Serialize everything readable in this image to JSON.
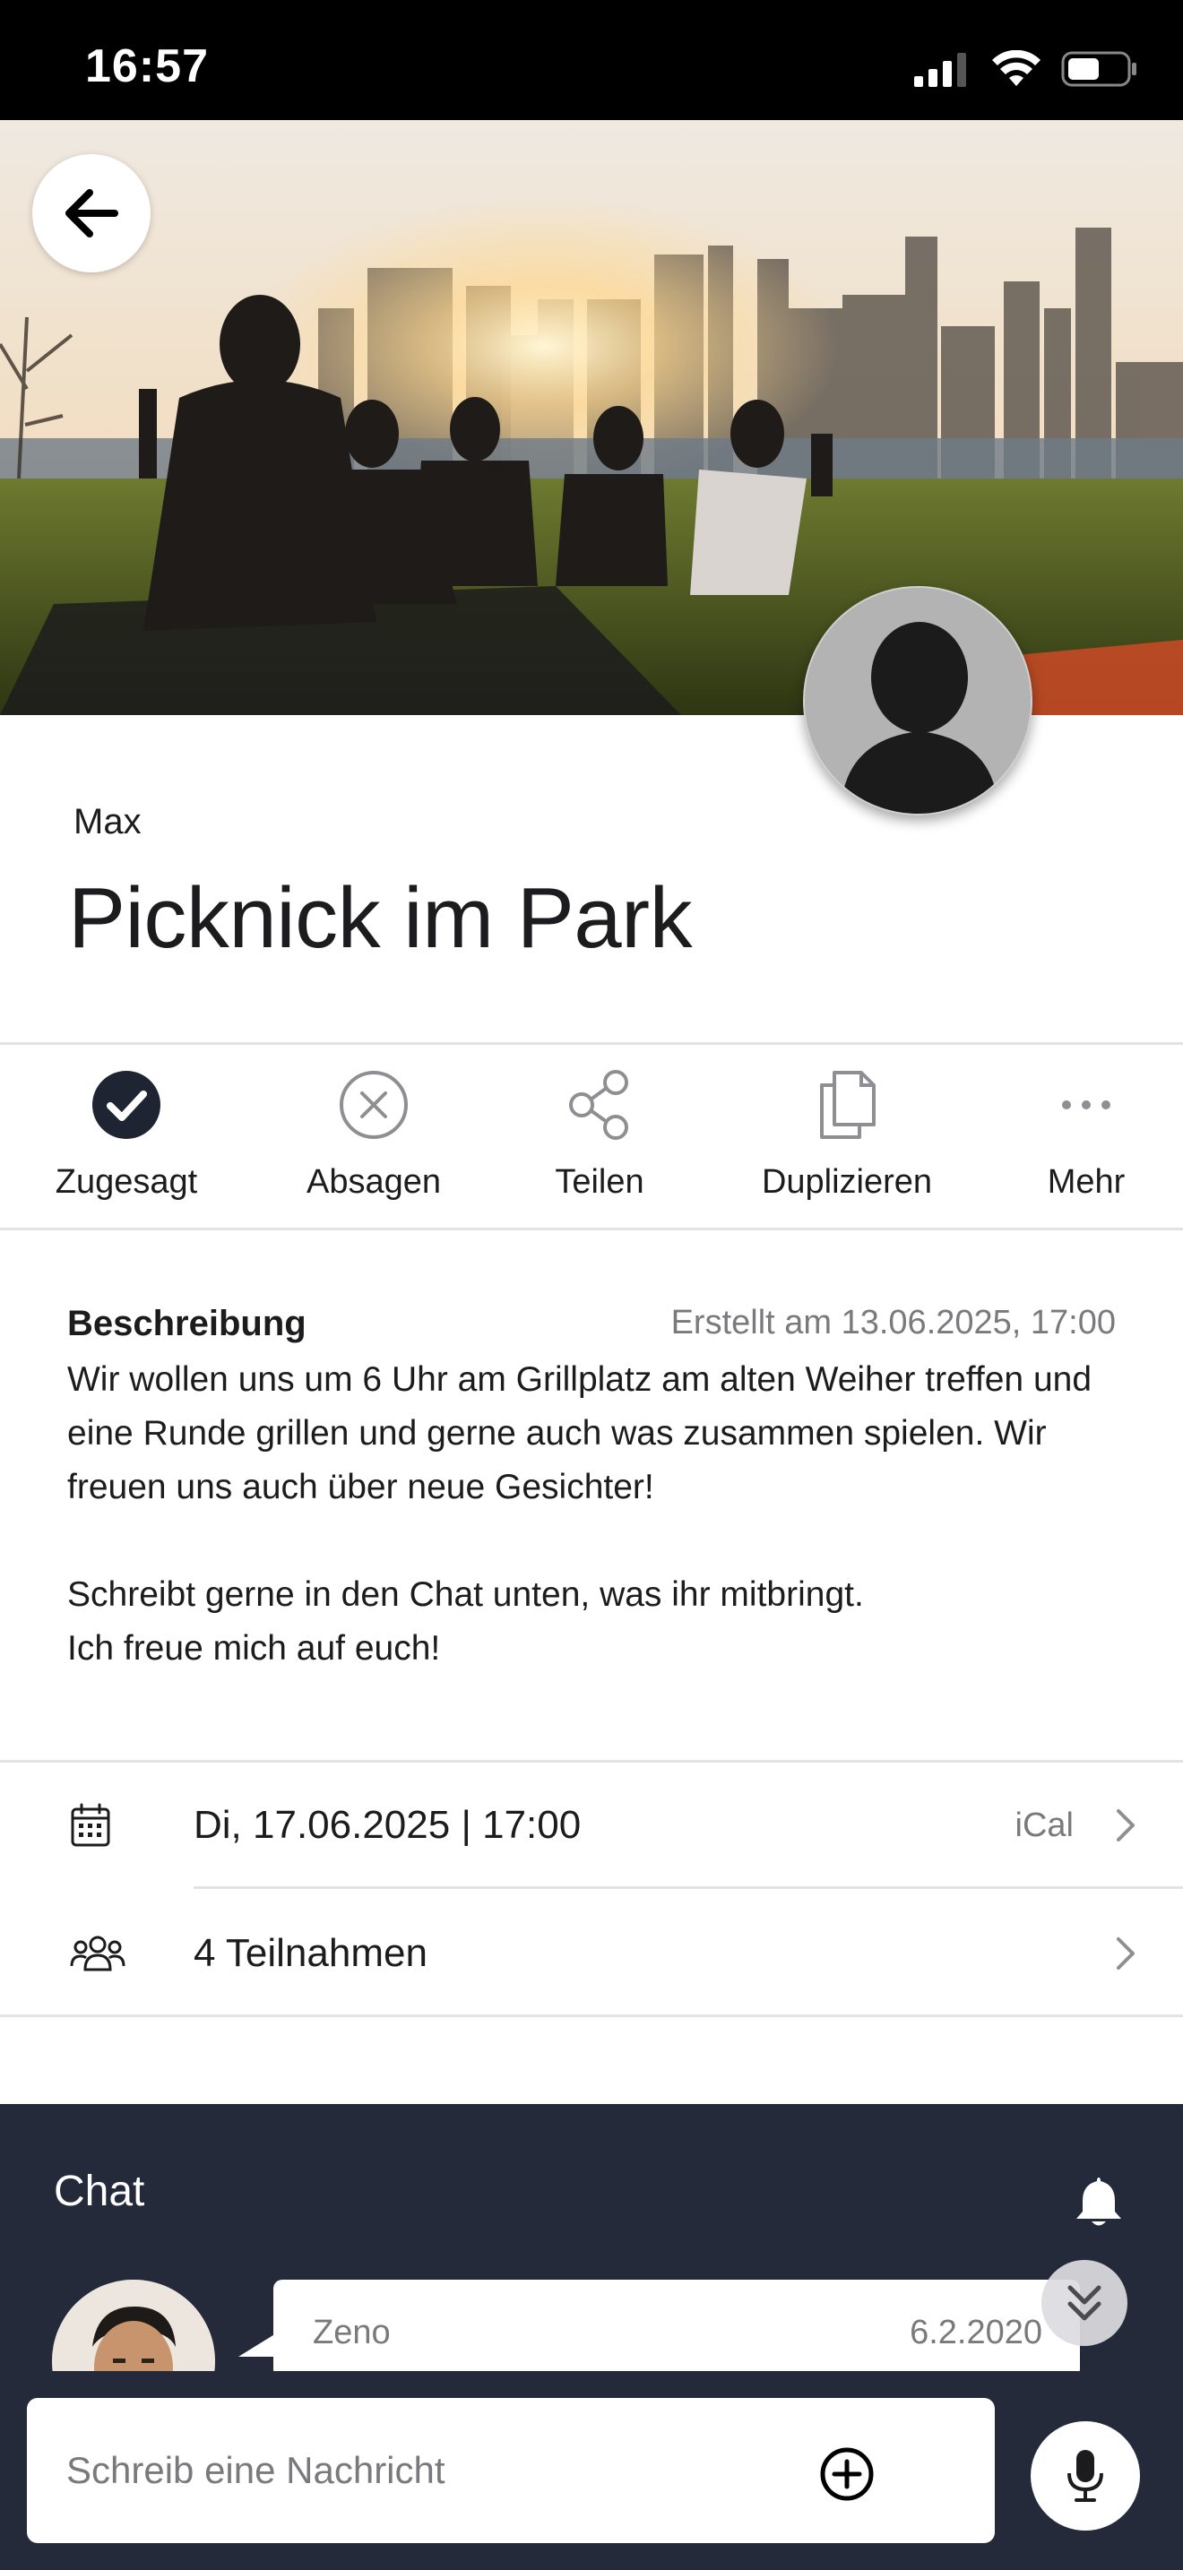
{
  "status_bar": {
    "time": "16:57"
  },
  "event": {
    "organizer": "Max",
    "title": "Picknick im Park"
  },
  "actions": [
    {
      "label": "Zugesagt",
      "icon": "check-circle-filled-icon"
    },
    {
      "label": "Absagen",
      "icon": "x-circle-icon"
    },
    {
      "label": "Teilen",
      "icon": "share-icon"
    },
    {
      "label": "Duplizieren",
      "icon": "copy-icon"
    },
    {
      "label": "Mehr",
      "icon": "more-horizontal-icon"
    }
  ],
  "description": {
    "heading": "Beschreibung",
    "created": "Erstellt am 13.06.2025, 17:00",
    "paragraphs": [
      "Wir wollen uns um 6 Uhr am Grillplatz am alten Weiher treffen und eine Runde grillen und gerne auch was zusammen spielen. Wir freuen uns auch über neue Gesichter!",
      "Schreibt gerne in den Chat unten, was ihr mitbringt.\nIch freue mich auf euch!"
    ]
  },
  "info": {
    "date": "Di, 17.06.2025 | 17:00",
    "ical": "iCal",
    "participants": "4 Teilnahmen"
  },
  "chat": {
    "title": "Chat",
    "message": {
      "sender": "Zeno",
      "date": "6.2.2020"
    },
    "input_placeholder": "Schreib eine Nachricht"
  },
  "colors": {
    "chat_background": "#252a3b",
    "accent_dark": "#1f2433",
    "divider": "#e3e3e6"
  }
}
